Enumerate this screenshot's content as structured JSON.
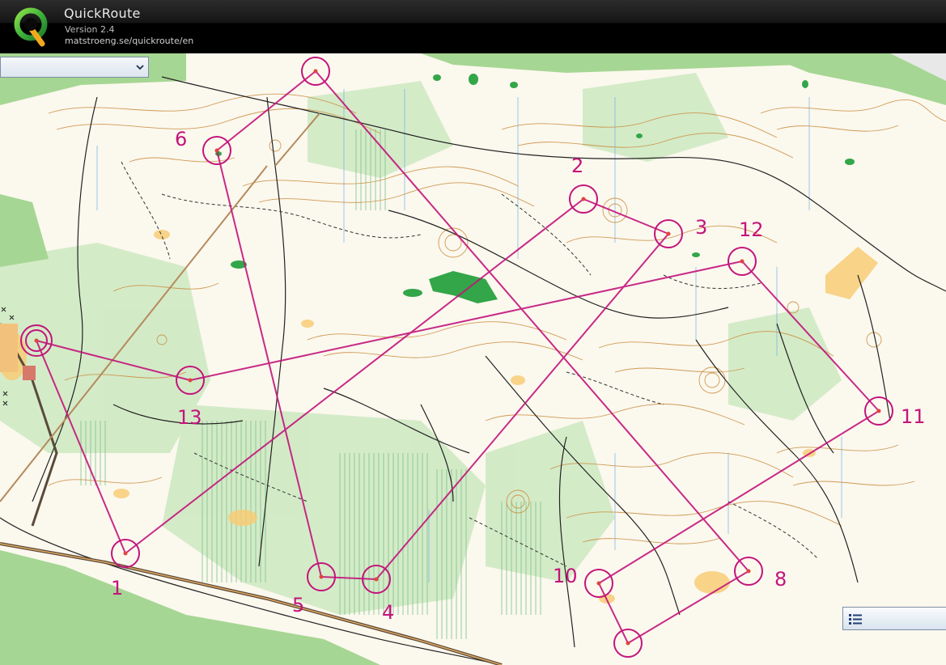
{
  "app": {
    "title": "QuickRoute",
    "version": "Version 2.4",
    "url": "matstroeng.se/quickroute/en",
    "logo_letter": "Q"
  },
  "selector": {
    "value": "",
    "icon": "chevron-down-icon"
  },
  "legend_button": {
    "icon": "list-icon"
  },
  "course": {
    "color": "#c3147b",
    "controls": [
      {
        "label": "1"
      },
      {
        "label": "2"
      },
      {
        "label": "3"
      },
      {
        "label": "4"
      },
      {
        "label": "5"
      },
      {
        "label": "6"
      },
      {
        "label": "8"
      },
      {
        "label": "10"
      },
      {
        "label": "11"
      },
      {
        "label": "12"
      },
      {
        "label": "13"
      }
    ]
  },
  "colors": {
    "map_background": "#fbf8ee",
    "open_land": "#f9d57e",
    "forest_green": "#a9d99a",
    "dark_green": "#3aa64a",
    "contour": "#c98a3a",
    "track": "#2a2a2a",
    "water": "#5aa7e0",
    "course": "#c3147b"
  }
}
